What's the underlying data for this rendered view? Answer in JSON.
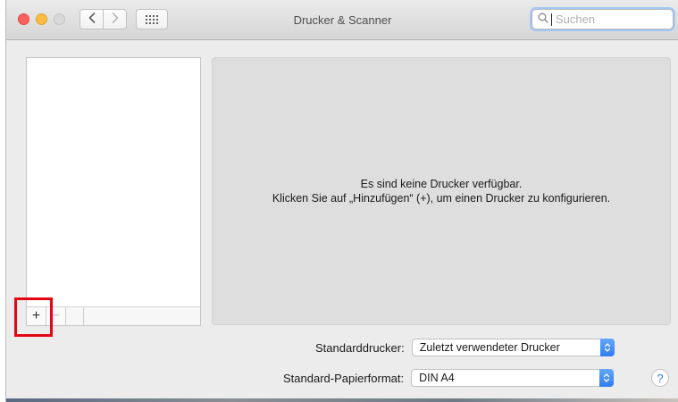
{
  "window": {
    "title": "Drucker & Scanner",
    "accent_color": "#2f7cf2",
    "highlight_color": "#e30613"
  },
  "toolbar": {
    "back_icon": "chevron-left-icon",
    "forward_icon": "chevron-right-icon",
    "grid_icon": "show-all-grid-icon"
  },
  "search": {
    "placeholder": "Suchen",
    "value": ""
  },
  "printer_list": {
    "items": [],
    "add_label": "+",
    "remove_label": "−"
  },
  "detail": {
    "message_line1": "Es sind keine Drucker verfügbar.",
    "message_line2": "Klicken Sie auf „Hinzufügen“ (+), um einen Drucker zu konfigurieren."
  },
  "settings": {
    "default_printer_label": "Standarddrucker:",
    "default_printer_value": "Zuletzt verwendeter Drucker",
    "paper_format_label": "Standard-Papierformat:",
    "paper_format_value": "DIN A4"
  },
  "help": {
    "label": "?"
  }
}
